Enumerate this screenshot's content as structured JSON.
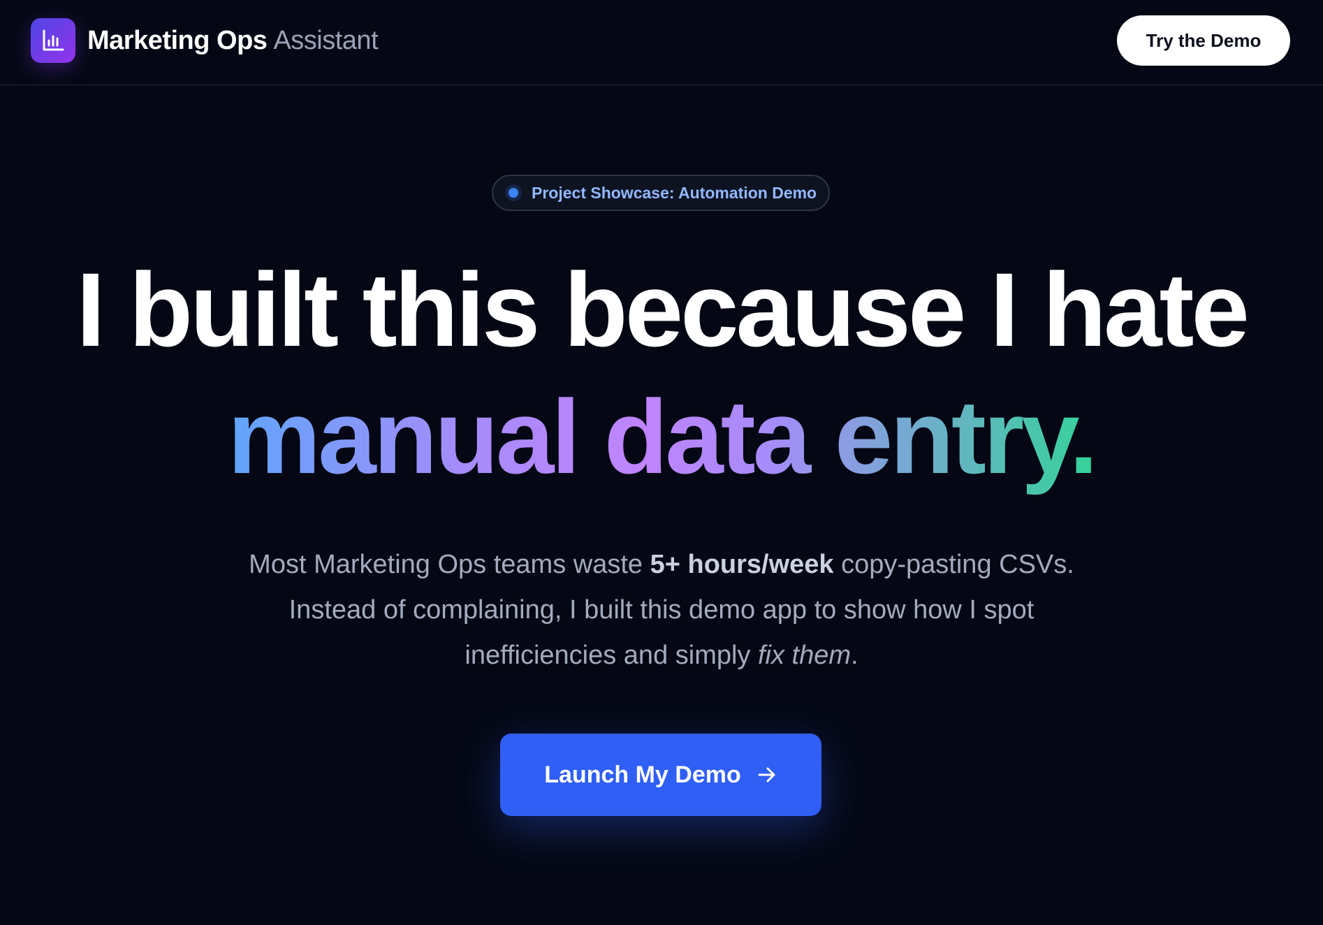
{
  "header": {
    "brand_strong": "Marketing Ops",
    "brand_light": "Assistant",
    "logo_icon": "bar-chart-icon",
    "cta_label": "Try the Demo"
  },
  "hero": {
    "badge_text": "Project Showcase: Automation Demo",
    "headline_line1": "I built this because I hate",
    "headline_line2": "manual data entry.",
    "description": {
      "line1_a": "Most Marketing Ops teams waste ",
      "line1_bold": "5+ hours/week",
      "line1_b": " copy-pasting CSVs.",
      "line2": "Instead of complaining, I built this demo app to show how I spot",
      "line3_a": "inefficiencies and simply ",
      "line3_italic": "fix them",
      "line3_b": "."
    },
    "primary_button_label": "Launch My Demo",
    "primary_button_icon": "arrow-right-icon"
  },
  "colors": {
    "background": "#050814",
    "accent_blue": "#2f5ff5",
    "logo_gradient_start": "#4f46e5",
    "logo_gradient_end": "#9333ea",
    "headline_gradient": [
      "#60a5fa",
      "#a78bfa",
      "#c084fc",
      "#34d399"
    ]
  }
}
